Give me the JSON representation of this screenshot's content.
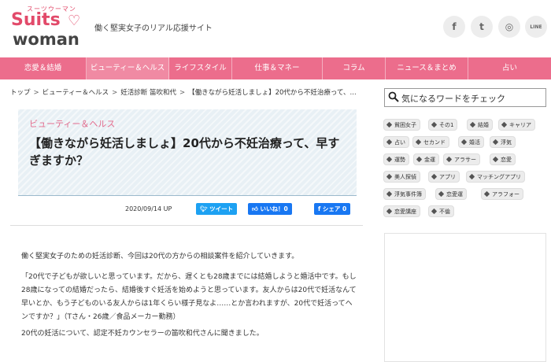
{
  "header": {
    "logo_small": "スーツウーマン",
    "logo_top": "Suits",
    "logo_bottom": "woman",
    "tagline": "働く堅実女子のリアル応援サイト",
    "social": [
      {
        "name": "facebook-icon",
        "glyph": "f"
      },
      {
        "name": "twitter-icon",
        "glyph": "t"
      },
      {
        "name": "instagram-icon",
        "glyph": "◎"
      },
      {
        "name": "line-icon",
        "glyph": "LINE"
      }
    ]
  },
  "nav": {
    "items": [
      "恋愛＆結婚",
      "ビューティー＆ヘルス",
      "ライフスタイル",
      "仕事＆マネー",
      "コラム",
      "ニュース＆まとめ",
      "占い"
    ],
    "active_index": 1,
    "color": "#ec6d8c"
  },
  "breadcrumb": {
    "items": [
      "トップ",
      "ビューティー＆ヘルス",
      "妊活診断 笛吹和代",
      "【働きながら妊活しましょ】20代から不妊治療って、..."
    ]
  },
  "article": {
    "category": "ビューティー＆ヘルス",
    "title": "【働きながら妊活しましょ】20代から不妊治療って、早すぎますか？",
    "date": "2020/09/14 UP",
    "tweet_label": "ツイート",
    "like_label": "いいね！0",
    "share_label": "シェア 0",
    "paragraphs": [
      "働く堅実女子のための妊活診断、今回は20代の方からの相談案件を紹介していきます。",
      "「20代で子どもが欲しいと思っています。だから、遅くとも28歳までには結婚しようと婚活中です。もし28歳になっての結婚だったら、結婚後すぐ妊活を始めようと思っています。友人からは20代で妊活なんて早いとか、もう子どものいる友人からは1年くらい様子見なよ……とか言われますが、20代で妊活ってヘンですか？」（Tさん・26歳／食品メーカー勤務）",
      "20代の妊活について、認定不妊カウンセラーの笛吹和代さんに聞きました。"
    ]
  },
  "sidebar": {
    "search_placeholder": "気になるワードをチェック",
    "tags": [
      "貧困女子",
      "その1",
      "結婚",
      "キャリア",
      "占い",
      "セカンド",
      "婚活",
      "浮気",
      "運勢",
      "金運",
      "アラサー",
      "恋愛",
      "美人探偵",
      "アプリ",
      "マッチングアプリ",
      "浮気事件簿",
      "恋愛運",
      "アラフォー",
      "恋愛講座",
      "不倫"
    ]
  }
}
